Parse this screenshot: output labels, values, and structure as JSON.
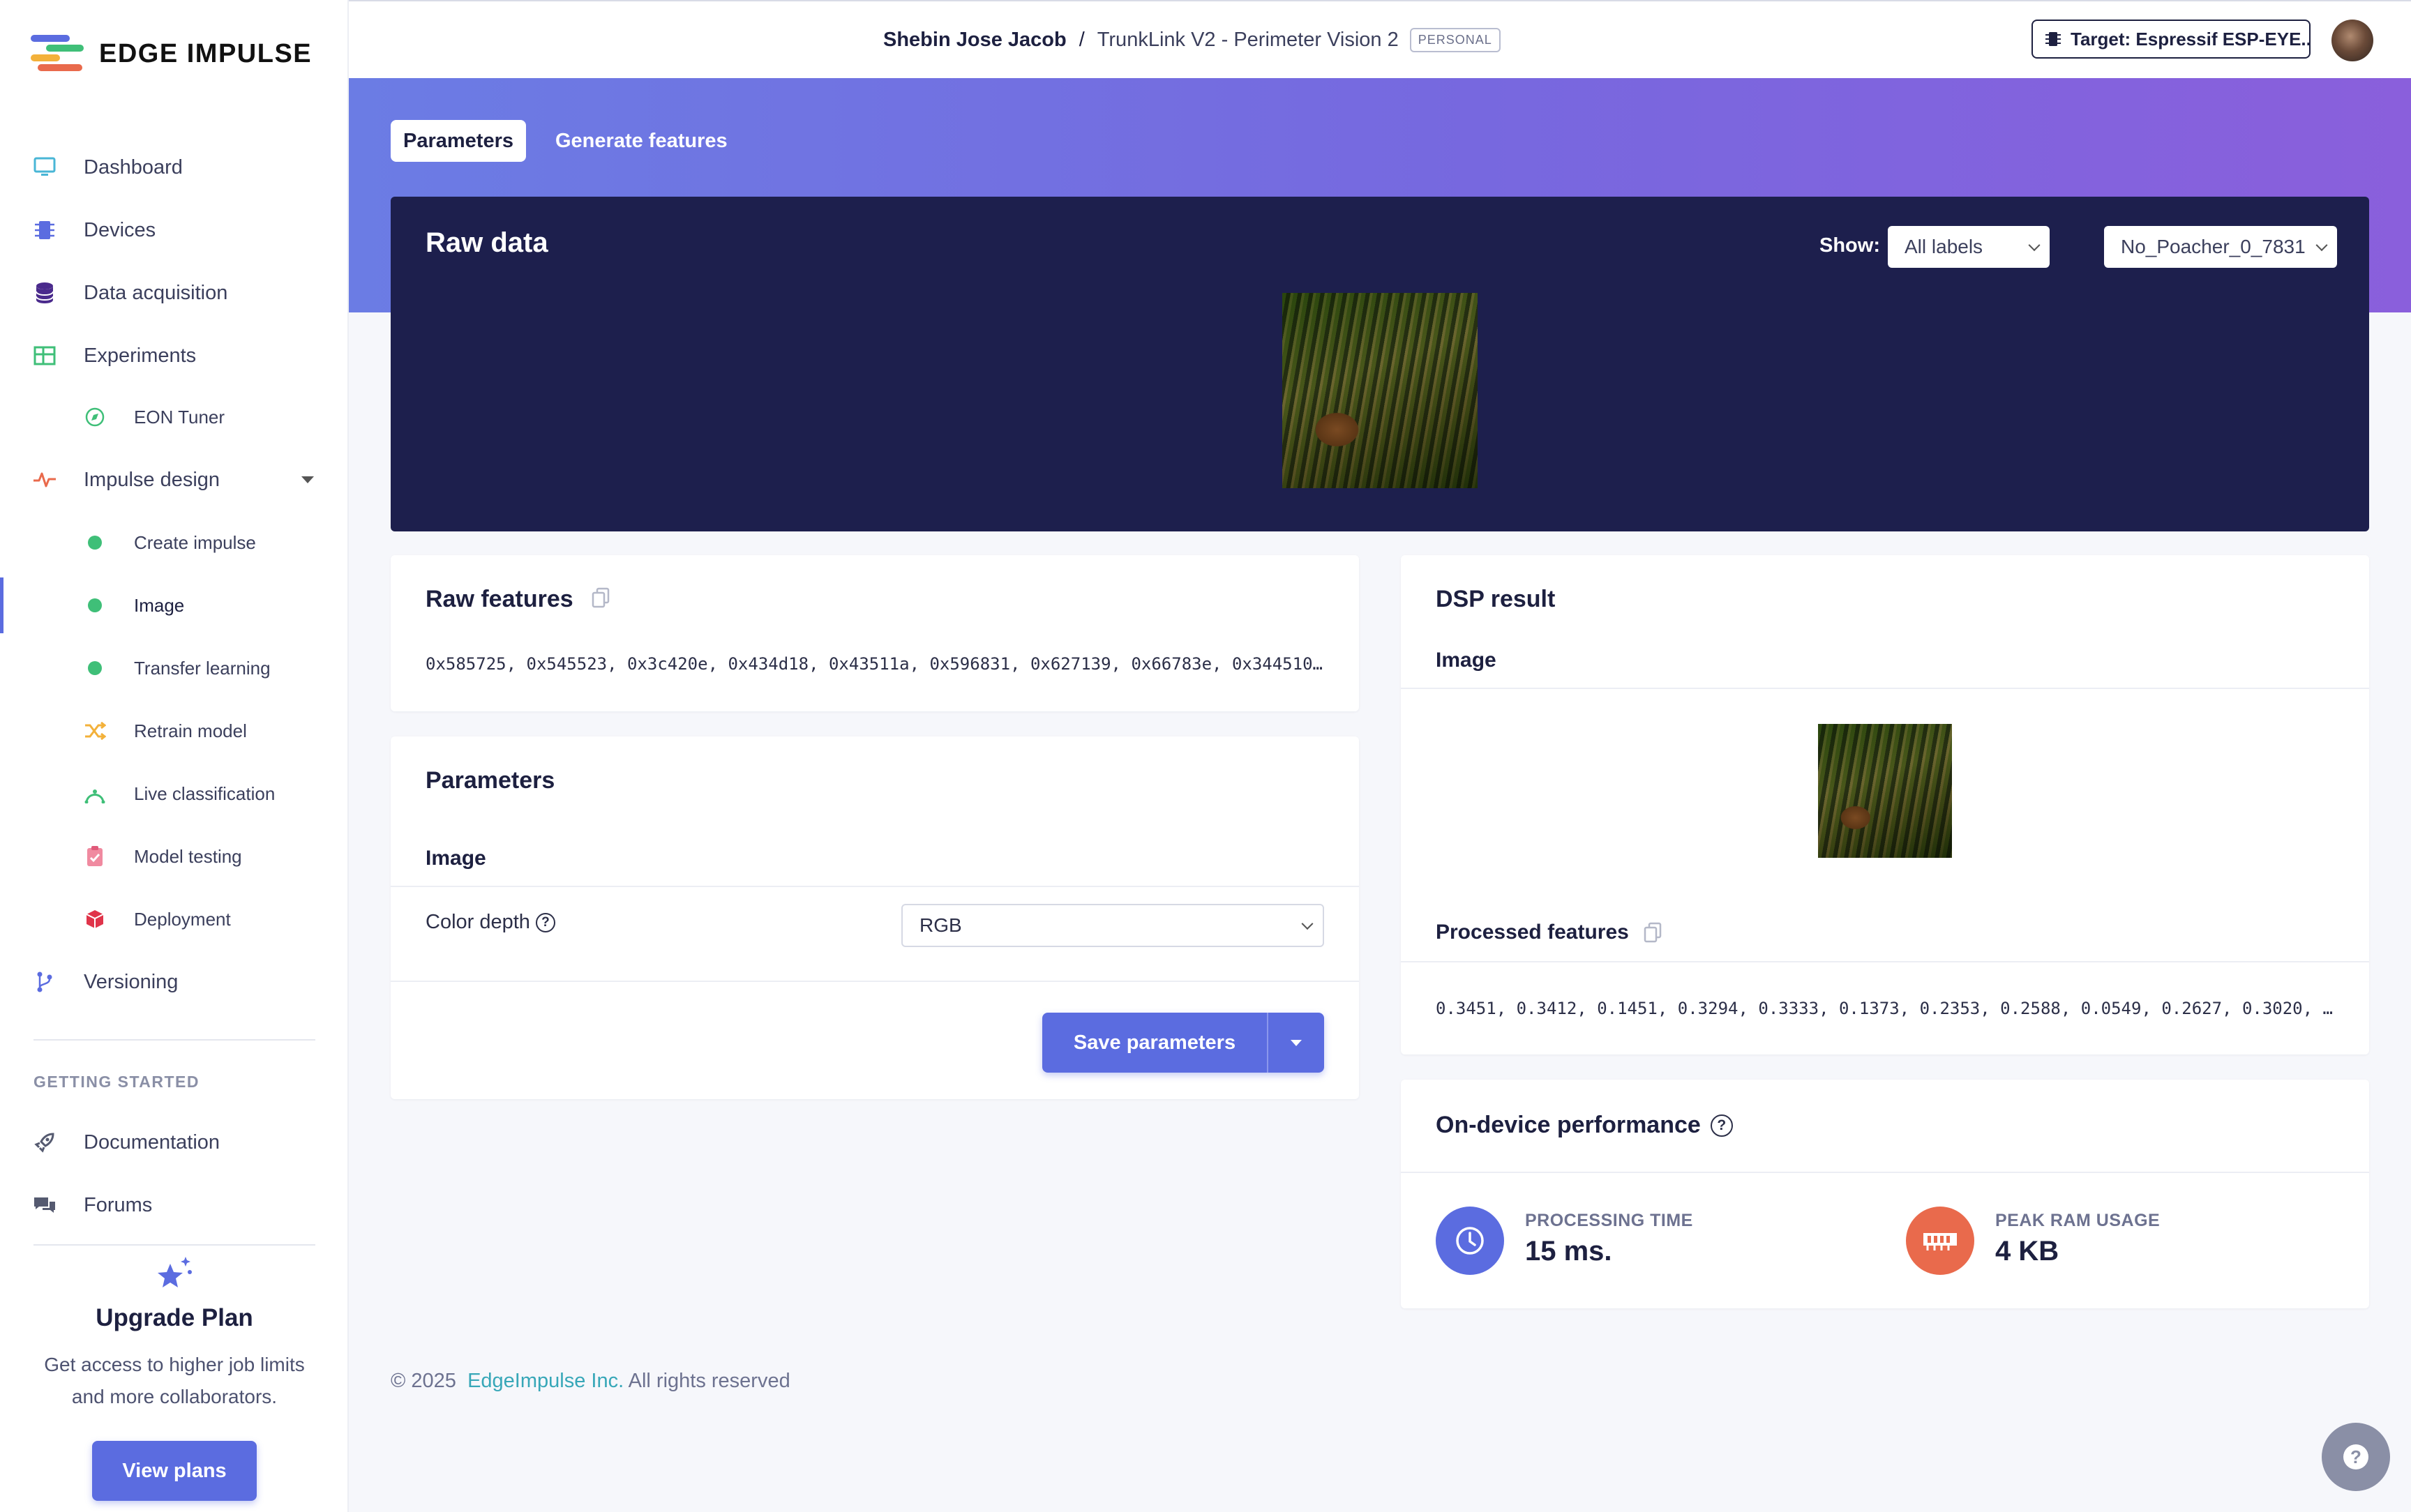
{
  "brand": {
    "name": "EDGE IMPULSE"
  },
  "sidebar": {
    "items": [
      {
        "label": "Dashboard",
        "icon": "monitor-icon"
      },
      {
        "label": "Devices",
        "icon": "chip-icon"
      },
      {
        "label": "Data acquisition",
        "icon": "database-icon"
      },
      {
        "label": "Experiments",
        "icon": "table-icon"
      },
      {
        "label": "EON Tuner",
        "icon": "compass-icon"
      },
      {
        "label": "Impulse design",
        "icon": "pulse-icon"
      },
      {
        "label": "Create impulse",
        "icon": "dot-icon"
      },
      {
        "label": "Image",
        "icon": "dot-icon"
      },
      {
        "label": "Transfer learning",
        "icon": "dot-icon"
      },
      {
        "label": "Retrain model",
        "icon": "shuffle-icon"
      },
      {
        "label": "Live classification",
        "icon": "antenna-icon"
      },
      {
        "label": "Model testing",
        "icon": "clipboard-check-icon"
      },
      {
        "label": "Deployment",
        "icon": "box-icon"
      },
      {
        "label": "Versioning",
        "icon": "branch-icon"
      }
    ],
    "getting_started": {
      "title": "GETTING STARTED",
      "items": [
        {
          "label": "Documentation",
          "icon": "rocket-icon"
        },
        {
          "label": "Forums",
          "icon": "chat-icon"
        }
      ]
    },
    "upgrade": {
      "title": "Upgrade Plan",
      "text": "Get access to higher job limits and more collaborators.",
      "button": "View plans"
    }
  },
  "header": {
    "owner": "Shebin Jose Jacob",
    "separator": "/",
    "project": "TrunkLink V2 - Perimeter Vision 2",
    "badge": "PERSONAL",
    "target": "Target: Espressif ESP-EYE..."
  },
  "tabs": [
    {
      "label": "Parameters"
    },
    {
      "label": "Generate features"
    }
  ],
  "raw_data": {
    "title": "Raw data",
    "show_label": "Show:",
    "label_filter": "All labels",
    "sample": "No_Poacher_0_7831"
  },
  "raw_features": {
    "title": "Raw features",
    "values": "0x585725, 0x545523, 0x3c420e, 0x434d18, 0x43511a, 0x596831, 0x627139, 0x66783e, 0x344510…"
  },
  "parameters": {
    "title": "Parameters",
    "section": "Image",
    "color_depth_label": "Color depth",
    "color_depth_value": "RGB",
    "save_button": "Save parameters"
  },
  "dsp_result": {
    "title": "DSP result",
    "image_label": "Image",
    "processed_label": "Processed features",
    "processed_values": "0.3451, 0.3412, 0.1451, 0.3294, 0.3333, 0.1373, 0.2353, 0.2588, 0.0549, 0.2627, 0.3020, …"
  },
  "performance": {
    "title": "On-device performance",
    "processing_time_label": "PROCESSING TIME",
    "processing_time_value": "15 ms.",
    "peak_ram_label": "PEAK RAM USAGE",
    "peak_ram_value": "4 KB"
  },
  "footer": {
    "copyright": "© 2025",
    "company": "EdgeImpulse Inc.",
    "rights": "All rights reserved"
  },
  "colors": {
    "accent": "#5b6ce0",
    "dark_panel": "#1d1f4d",
    "success": "#3fbf78",
    "time_circle": "#5b6ce0",
    "ram_circle": "#e96a4c"
  }
}
